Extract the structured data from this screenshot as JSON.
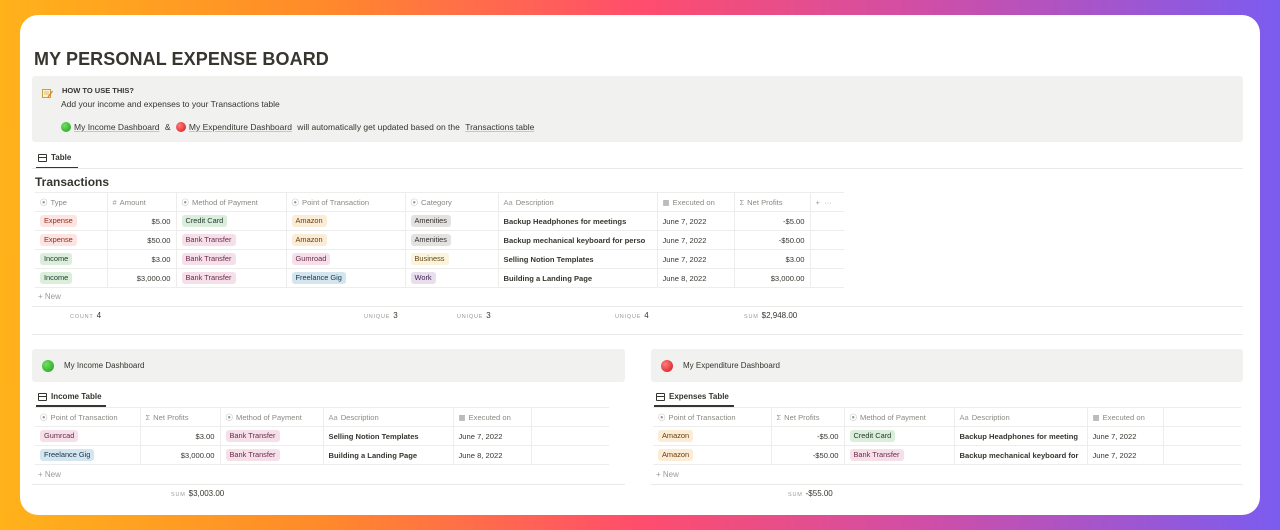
{
  "page": {
    "title": "MY PERSONAL EXPENSE BOARD"
  },
  "callout": {
    "icon": "memo-icon",
    "heading": "HOW TO USE THIS?",
    "line1_prefix": "Add your income and expenses to your ",
    "line1_link": "Transactions table",
    "line2_link1": "My Income Dashboard",
    "line2_amp": " & ",
    "line2_link2": "My Expenditure Dashboard",
    "line2_middle": " will automatically get updated based on the ",
    "line2_link3": "Transactions table"
  },
  "transactions": {
    "view_tab": "Table",
    "title": "Transactions",
    "columns": [
      "Type",
      "Amount",
      "Method of Payment",
      "Point of Transaction",
      "Category",
      "Description",
      "Executed on",
      "Net Profits"
    ],
    "rows": [
      {
        "type": "Expense",
        "amount": "$5.00",
        "method": "Credit Card",
        "point": "Amazon",
        "category": "Amenities",
        "description": "Backup Headphones for meetings",
        "executed": "June 7, 2022",
        "net": "-$5.00"
      },
      {
        "type": "Expense",
        "amount": "$50.00",
        "method": "Bank Transfer",
        "point": "Amazon",
        "category": "Amenities",
        "description": "Backup mechanical keyboard for perso",
        "executed": "June 7, 2022",
        "net": "-$50.00"
      },
      {
        "type": "Income",
        "amount": "$3.00",
        "method": "Bank Transfer",
        "point": "Gumroad",
        "category": "Business",
        "description": "Selling Notion Templates",
        "executed": "June 7, 2022",
        "net": "$3.00"
      },
      {
        "type": "Income",
        "amount": "$3,000.00",
        "method": "Bank Transfer",
        "point": "Freelance Gig",
        "category": "Work",
        "description": "Building a Landing Page",
        "executed": "June 8, 2022",
        "net": "$3,000.00"
      }
    ],
    "new_label": "+ New",
    "calcs": {
      "count_label": "COUNT",
      "count_value": "4",
      "unique1_label": "UNIQUE",
      "unique1_value": "3",
      "unique2_label": "UNIQUE",
      "unique2_value": "3",
      "unique3_label": "UNIQUE",
      "unique3_value": "4",
      "sum_label": "SUM",
      "sum_value": "$2,948.00"
    }
  },
  "income": {
    "header": "My Income Dashboard",
    "view_tab": "Income Table",
    "columns": [
      "Point of Transaction",
      "Net Profits",
      "Method of Payment",
      "Description",
      "Executed on"
    ],
    "rows": [
      {
        "point": "Gumrcad",
        "net": "$3.00",
        "method": "Bank Transfer",
        "description": "Selling Notion Templates",
        "executed": "June 7, 2022"
      },
      {
        "point": "Freelance Gig",
        "net": "$3,000.00",
        "method": "Bank Transfer",
        "description": "Building a Landing Page",
        "executed": "June 8, 2022"
      }
    ],
    "new_label": "+ New",
    "sum_label": "SUM",
    "sum_value": "$3,003.00"
  },
  "expenditure": {
    "header": "My Expenditure Dashboard",
    "view_tab": "Expenses Table",
    "columns": [
      "Point of Transaction",
      "Net Profits",
      "Method of Payment",
      "Description",
      "Executed on"
    ],
    "rows": [
      {
        "point": "Amazon",
        "net": "-$5.00",
        "method": "Credit Card",
        "description": "Backup Headphones for meeting",
        "executed": "June 7, 2022"
      },
      {
        "point": "Amazon",
        "net": "-$50.00",
        "method": "Bank Transfer",
        "description": "Backup mechanical keyboard for",
        "executed": "June 7, 2022"
      }
    ],
    "new_label": "+ New",
    "sum_label": "SUM",
    "sum_value": "-$55.00"
  },
  "colors": {
    "accent_green": "#1e9e19",
    "accent_red": "#d3141a",
    "callout_bg": "#f1f1ef"
  }
}
